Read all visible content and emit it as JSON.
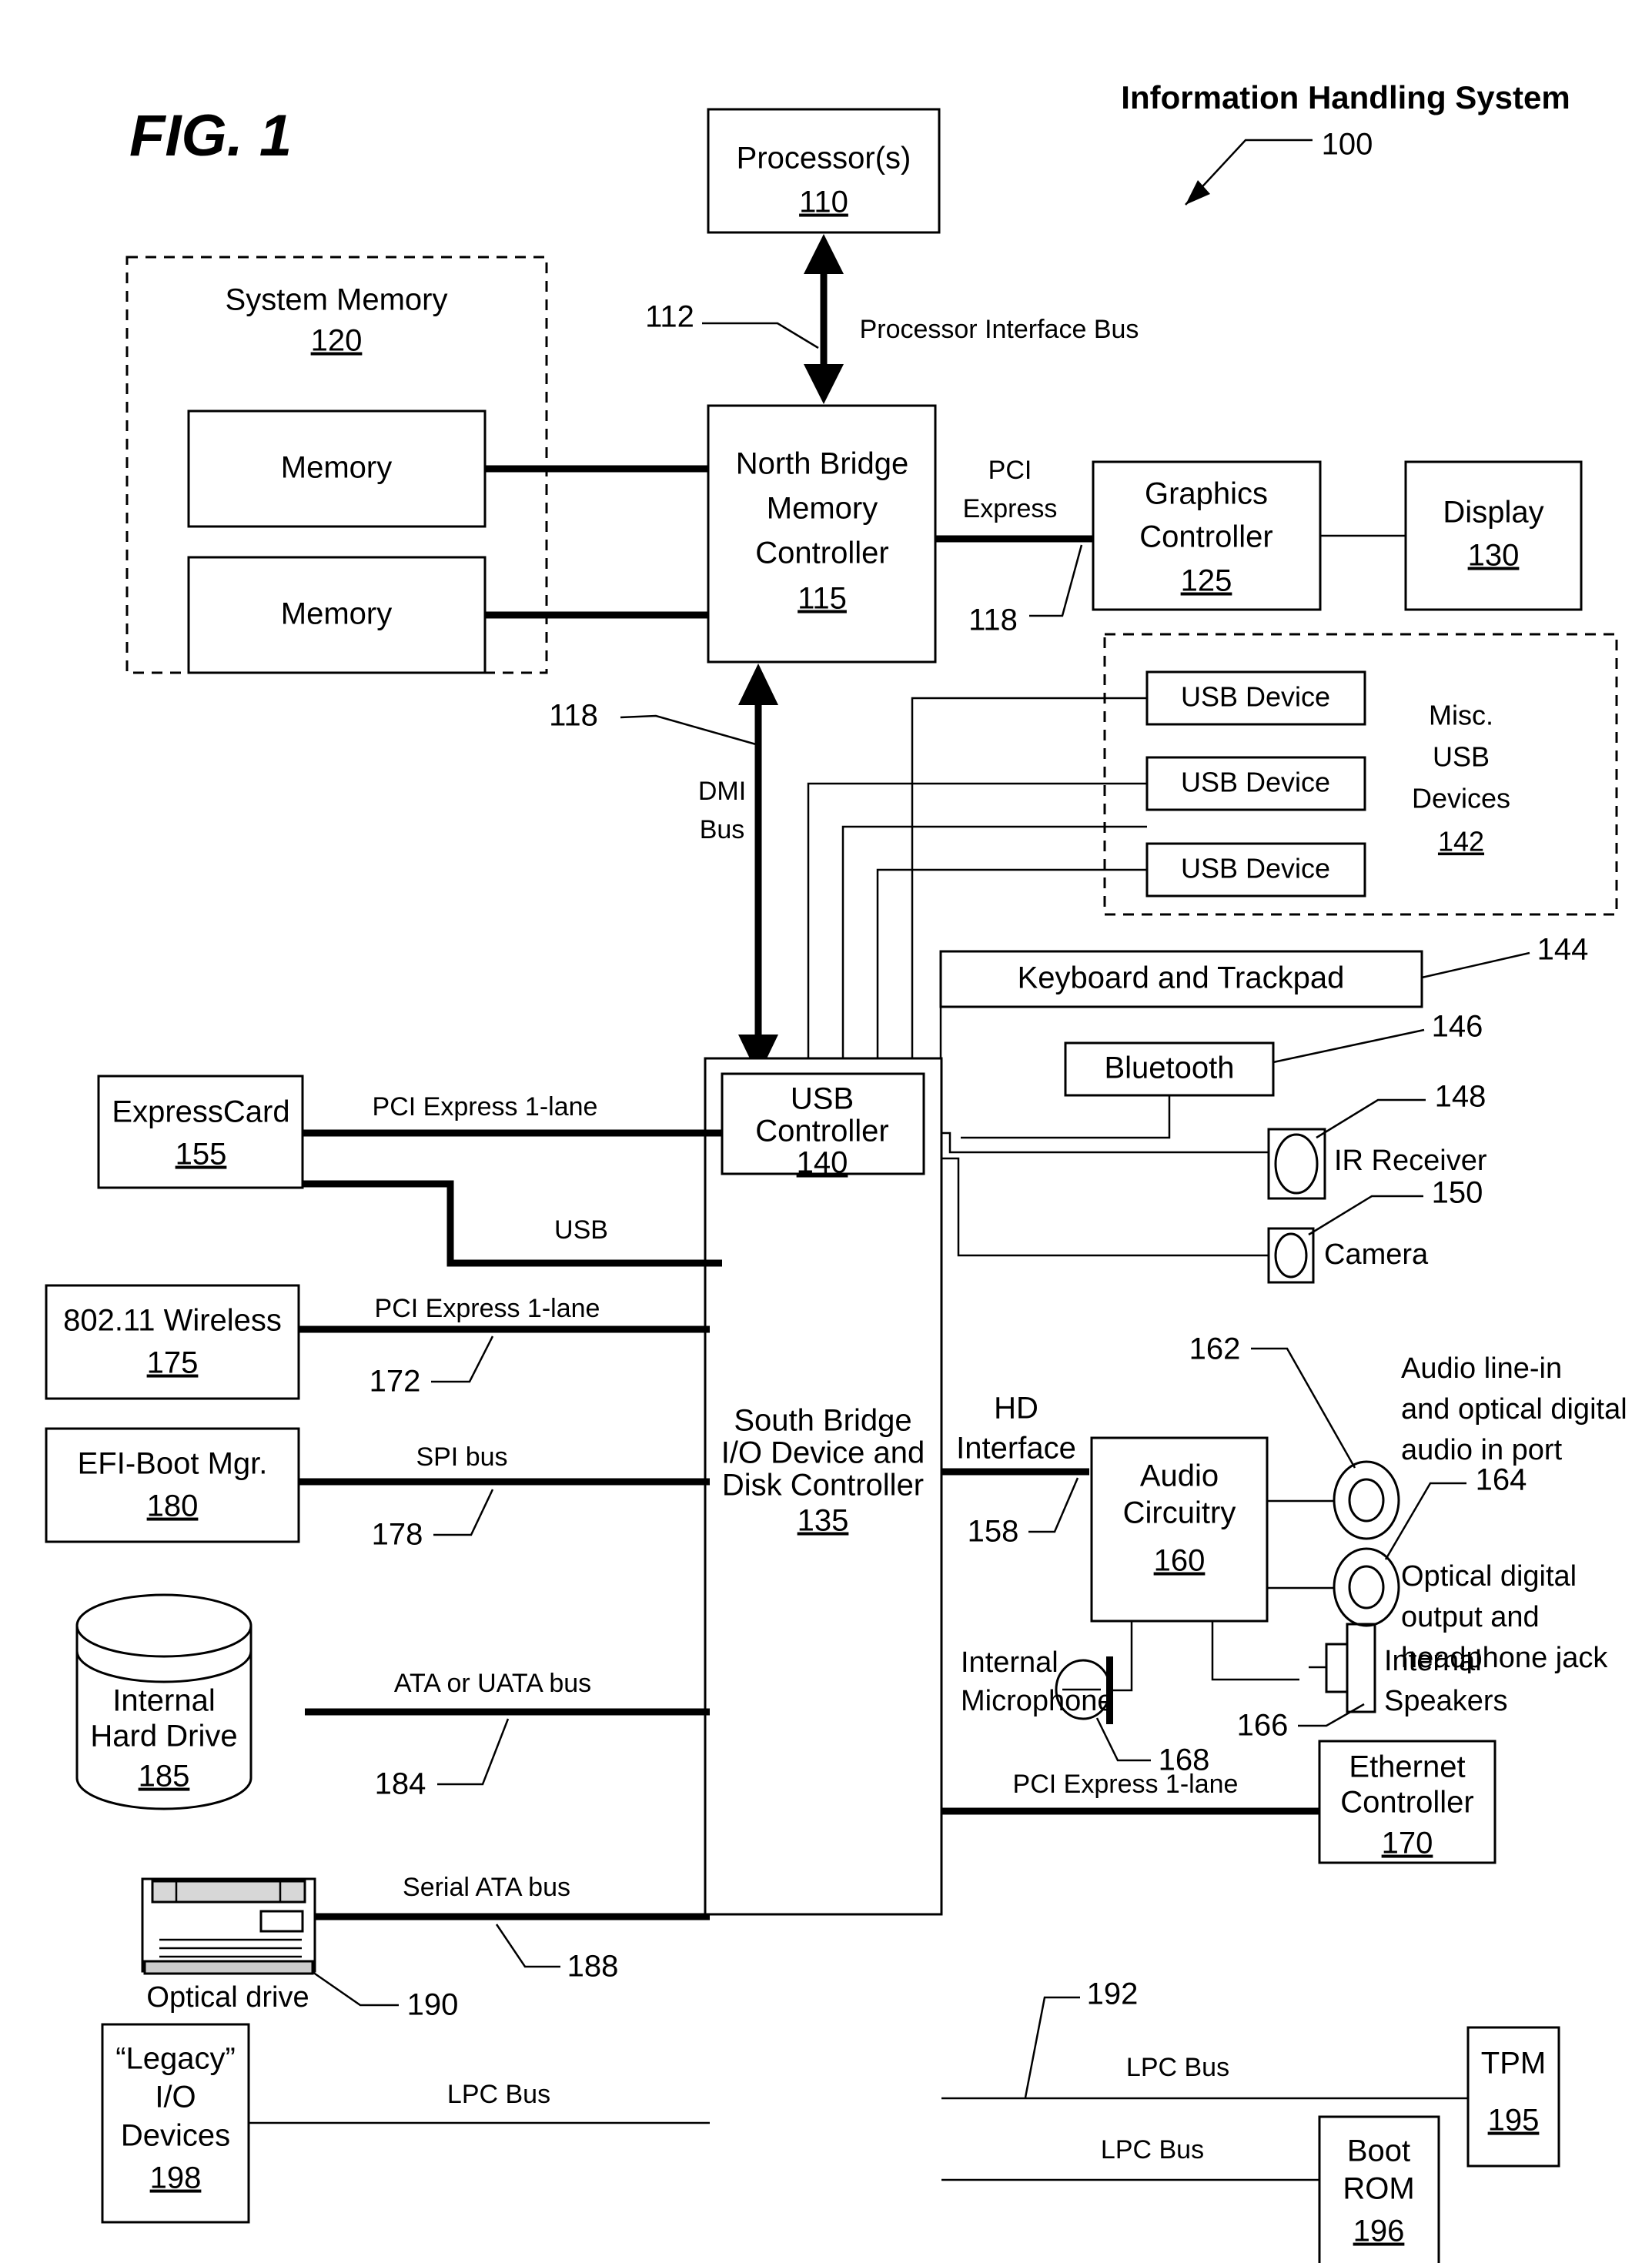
{
  "figure": {
    "label": "FIG. 1",
    "title": "Information Handling System",
    "title_ref": "100"
  },
  "blocks": {
    "system_memory": {
      "label": "System Memory",
      "ref": "120"
    },
    "memory_1": {
      "label": "Memory"
    },
    "memory_2": {
      "label": "Memory"
    },
    "processor": {
      "label": "Processor(s)",
      "ref": "110"
    },
    "north_bridge": {
      "line1": "North Bridge",
      "line2": "Memory",
      "line3": "Controller",
      "ref": "115"
    },
    "graphics": {
      "line1": "Graphics",
      "line2": "Controller",
      "ref": "125"
    },
    "display": {
      "label": "Display",
      "ref": "130"
    },
    "usb_device_1": {
      "label": "USB Device"
    },
    "usb_device_2": {
      "label": "USB Device"
    },
    "usb_device_3": {
      "label": "USB Device"
    },
    "misc_usb": {
      "line1": "Misc.",
      "line2": "USB",
      "line3": "Devices",
      "ref": "142"
    },
    "keyboard": {
      "label": "Keyboard and Trackpad",
      "ref": "144"
    },
    "bluetooth": {
      "label": "Bluetooth",
      "ref": "146"
    },
    "ir_receiver": {
      "label": "IR Receiver",
      "ref": "148"
    },
    "camera": {
      "label": "Camera",
      "ref": "150"
    },
    "usb_controller": {
      "line1": "USB",
      "line2": "Controller",
      "ref": "140"
    },
    "south_bridge": {
      "line1": "South Bridge",
      "line2": "I/O Device and",
      "line3": "Disk Controller",
      "ref": "135"
    },
    "expresscard": {
      "label": "ExpressCard",
      "ref": "155"
    },
    "wireless": {
      "label": "802.11 Wireless",
      "ref": "175"
    },
    "efi_boot_mgr": {
      "label": "EFI-Boot Mgr.",
      "ref": "180"
    },
    "hard_drive": {
      "line1": "Internal",
      "line2": "Hard Drive",
      "ref": "185"
    },
    "optical_drive": {
      "label": "Optical drive",
      "ref": "190"
    },
    "legacy_io": {
      "line1": "“Legacy”",
      "line2": "I/O",
      "line3": "Devices",
      "ref": "198"
    },
    "audio_circuitry": {
      "line1": "Audio",
      "line2": "Circuitry",
      "ref": "160"
    },
    "audio_line_in": {
      "line1": "Audio line-in",
      "line2": "and optical digital",
      "line3": "audio in port",
      "ref": "162"
    },
    "optical_out": {
      "line1": "Optical digital",
      "line2": "output and",
      "line3": "headphone jack",
      "ref": "164"
    },
    "internal_mic": {
      "line1": "Internal",
      "line2": "Microphone",
      "ref": "168"
    },
    "internal_speakers": {
      "line1": "Internal",
      "line2": "Speakers",
      "ref": "166"
    },
    "ethernet": {
      "line1": "Ethernet",
      "line2": "Controller",
      "ref": "170"
    },
    "tpm": {
      "label": "TPM",
      "ref": "195"
    },
    "boot_rom": {
      "line1": "Boot",
      "line2": "ROM",
      "ref": "196"
    }
  },
  "buses": {
    "processor_interface": {
      "label": "Processor Interface Bus",
      "ref": "112"
    },
    "pci_express_gfx": {
      "line1": "PCI",
      "line2": "Express",
      "ref": "118"
    },
    "dmi": {
      "line1": "DMI",
      "line2": "Bus",
      "ref": "118"
    },
    "pcie_expresscard": {
      "label": "PCI Express 1-lane"
    },
    "usb_expresscard": {
      "label": "USB"
    },
    "pcie_wireless": {
      "label": "PCI Express 1-lane",
      "ref": "172"
    },
    "spi": {
      "label": "SPI bus",
      "ref": "178"
    },
    "ata": {
      "label": "ATA or UATA bus",
      "ref": "184"
    },
    "serial_ata": {
      "label": "Serial ATA bus",
      "ref": "188"
    },
    "lpc_legacy": {
      "label": "LPC Bus"
    },
    "hd_interface": {
      "line1": "HD",
      "line2": "Interface",
      "ref": "158"
    },
    "pcie_ethernet": {
      "label": "PCI Express 1-lane"
    },
    "lpc_tpm": {
      "label": "LPC Bus",
      "ref": "192"
    },
    "lpc_boot_rom": {
      "label": "LPC Bus"
    }
  },
  "colors": {
    "stroke": "#000000",
    "background": "#ffffff"
  }
}
